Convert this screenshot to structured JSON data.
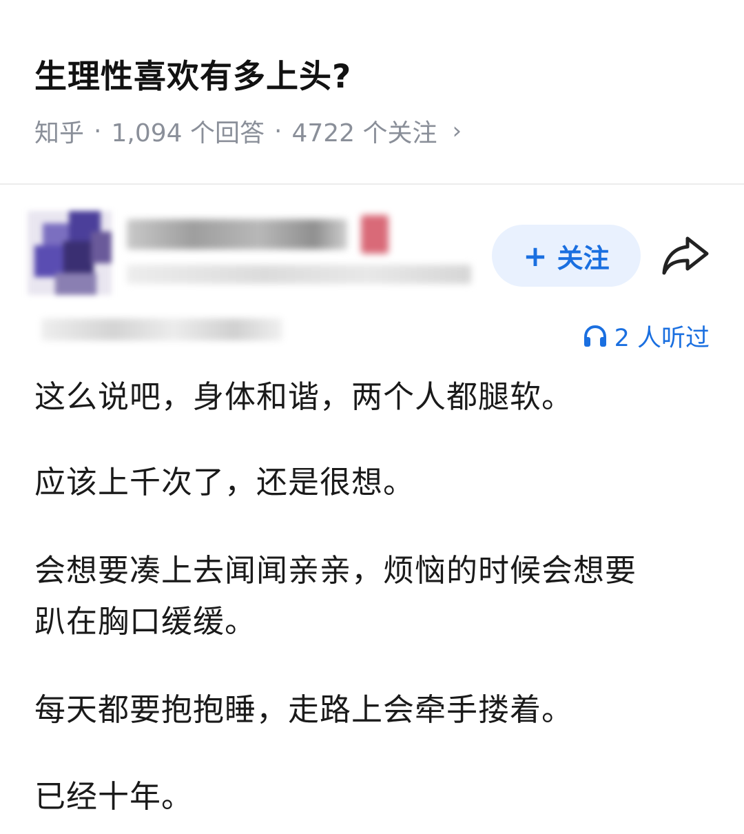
{
  "question": {
    "title": "生理性喜欢有多上头?",
    "source": "知乎",
    "answers": "1,094 个回答",
    "followers": "4722 个关注",
    "separator": "·",
    "chevron": "›"
  },
  "author": {
    "follow_label": "关注",
    "follow_icon": "plus-icon",
    "share_icon": "share-arrow-icon"
  },
  "listen": {
    "icon": "headphones-icon",
    "text": "2 人听过"
  },
  "answer": {
    "paragraphs": [
      "这么说吧，身体和谐，两个人都腿软。",
      "应该上千次了，还是很想。",
      "会想要凑上去闻闻亲亲，烦恼的时候会想要",
      "趴在胸口缓缓。",
      "每天都要抱抱睡，走路上会牵手搂着。",
      "已经十年。"
    ]
  },
  "colors": {
    "accent": "#1a6fe0",
    "follow_bg": "#e9f1fe",
    "meta_text": "#8a8f99"
  }
}
